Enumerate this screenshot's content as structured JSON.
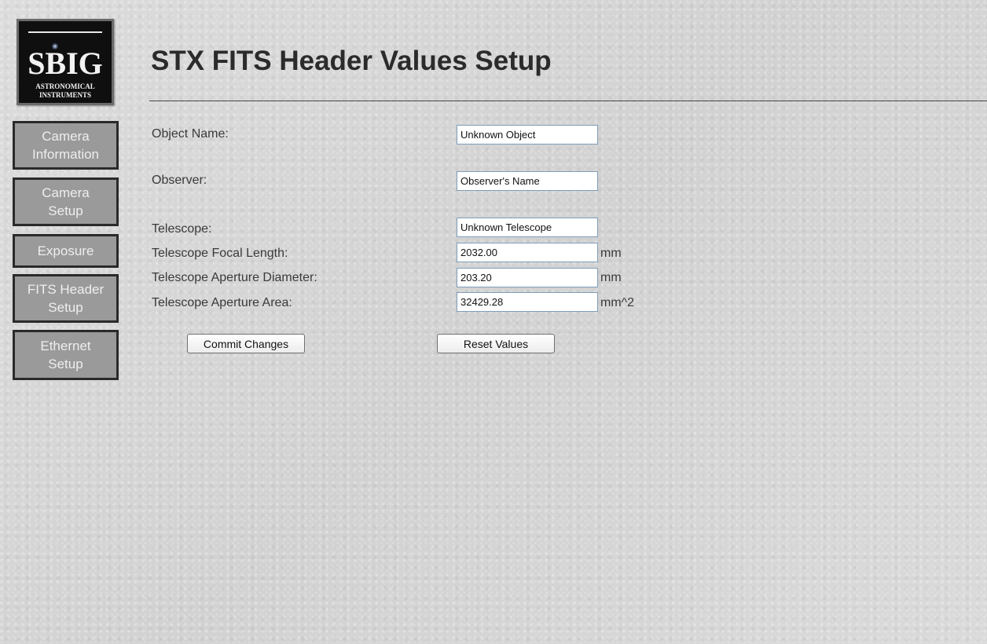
{
  "logo": {
    "brand": "SBIG",
    "subtitle_line1": "ASTRONOMICAL",
    "subtitle_line2": "INSTRUMENTS"
  },
  "sidebar": {
    "items": [
      {
        "line1": "Camera",
        "line2": "Information"
      },
      {
        "line1": "Camera",
        "line2": "Setup"
      },
      {
        "line1": "Exposure",
        "line2": ""
      },
      {
        "line1": "FITS Header",
        "line2": "Setup"
      },
      {
        "line1": "Ethernet",
        "line2": "Setup"
      }
    ]
  },
  "header": {
    "title": "STX FITS Header Values Setup"
  },
  "form": {
    "object_name": {
      "label": "Object Name:",
      "value": "Unknown Object"
    },
    "observer": {
      "label": "Observer:",
      "value": "Observer's Name"
    },
    "telescope": {
      "label": "Telescope:",
      "value": "Unknown Telescope"
    },
    "focal_length": {
      "label": "Telescope Focal Length:",
      "value": "2032.00",
      "unit": "mm"
    },
    "aperture_diameter": {
      "label": "Telescope Aperture Diameter:",
      "value": "203.20",
      "unit": "mm"
    },
    "aperture_area": {
      "label": "Telescope Aperture Area:",
      "value": "32429.28",
      "unit": "mm^2"
    }
  },
  "actions": {
    "commit_label": "Commit Changes",
    "reset_label": "Reset Values"
  },
  "colors": {
    "nav_background": "#9a9a9a",
    "nav_border": "#2a2a2a",
    "nav_text": "#eeeeee",
    "input_border": "#7f9db9"
  }
}
